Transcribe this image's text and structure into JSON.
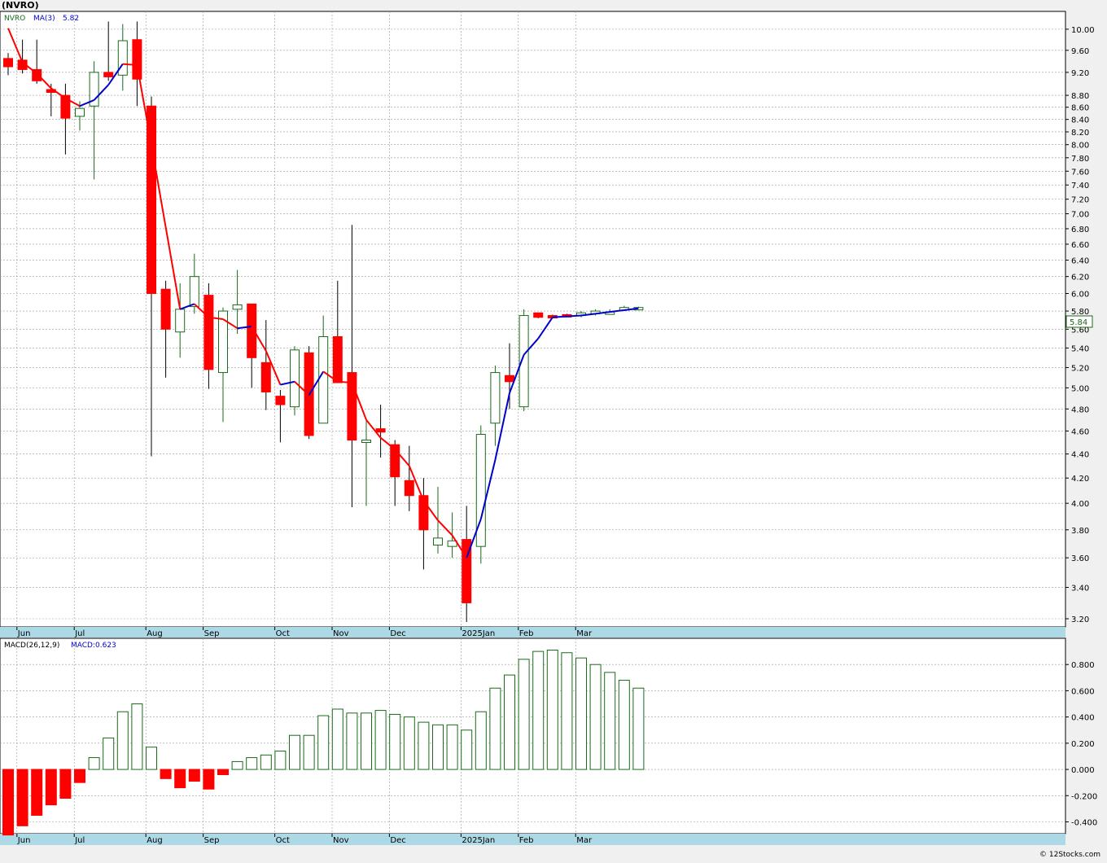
{
  "page": {
    "title": "(NVRO)",
    "footer": "© 12Stocks.com",
    "colors": {
      "up": "#1a6b1a",
      "down": "#ff0000",
      "ma_red": "#ff0000",
      "ma_blue": "#0000cc",
      "axis_band": "#add8e6",
      "grid": "#999999"
    }
  },
  "chart_data": [
    {
      "type": "candlestick",
      "legend": {
        "symbol": "NVRO",
        "ma_label": "MA(3)",
        "ma_value": "5.82"
      },
      "last_price_badge": "5.84",
      "ylim": [
        3.15,
        10.35
      ],
      "y_ticks": [
        "3.20",
        "3.40",
        "3.60",
        "3.80",
        "4.00",
        "4.20",
        "4.40",
        "4.60",
        "4.80",
        "5.00",
        "5.20",
        "5.40",
        "5.60",
        "5.80",
        "6.00",
        "6.20",
        "6.40",
        "6.60",
        "6.80",
        "7.00",
        "7.20",
        "7.40",
        "7.60",
        "7.80",
        "8.00",
        "8.20",
        "8.40",
        "8.60",
        "8.80",
        "9.20",
        "9.60",
        "10.00"
      ],
      "x_labels": [
        {
          "label": "Jun",
          "index": 1
        },
        {
          "label": "Jul",
          "index": 5
        },
        {
          "label": "Aug",
          "index": 10
        },
        {
          "label": "Sep",
          "index": 14
        },
        {
          "label": "Oct",
          "index": 19
        },
        {
          "label": "Nov",
          "index": 23
        },
        {
          "label": "Dec",
          "index": 27
        },
        {
          "label": "2025Jan",
          "index": 32
        },
        {
          "label": "Feb",
          "index": 36
        },
        {
          "label": "Mar",
          "index": 40
        }
      ],
      "candles": [
        {
          "o": 9.45,
          "h": 9.55,
          "l": 9.15,
          "c": 9.3
        },
        {
          "o": 9.42,
          "h": 9.8,
          "l": 9.18,
          "c": 9.25
        },
        {
          "o": 9.25,
          "h": 9.8,
          "l": 9.0,
          "c": 9.05
        },
        {
          "o": 8.9,
          "h": 9.0,
          "l": 8.45,
          "c": 8.85
        },
        {
          "o": 8.8,
          "h": 9.0,
          "l": 7.85,
          "c": 8.42
        },
        {
          "o": 8.45,
          "h": 8.7,
          "l": 8.22,
          "c": 8.58
        },
        {
          "o": 8.62,
          "h": 9.4,
          "l": 7.48,
          "c": 9.2
        },
        {
          "o": 9.2,
          "h": 10.15,
          "l": 9.05,
          "c": 9.12
        },
        {
          "o": 9.15,
          "h": 10.1,
          "l": 8.88,
          "c": 9.78
        },
        {
          "o": 9.8,
          "h": 10.15,
          "l": 8.62,
          "c": 9.08
        },
        {
          "o": 8.62,
          "h": 8.78,
          "l": 4.38,
          "c": 6.0
        },
        {
          "o": 6.05,
          "h": 6.15,
          "l": 5.1,
          "c": 5.6
        },
        {
          "o": 5.57,
          "h": 6.12,
          "l": 5.3,
          "c": 5.82
        },
        {
          "o": 5.85,
          "h": 6.48,
          "l": 5.77,
          "c": 6.2
        },
        {
          "o": 5.98,
          "h": 6.12,
          "l": 4.99,
          "c": 5.18
        },
        {
          "o": 5.15,
          "h": 5.84,
          "l": 4.68,
          "c": 5.8
        },
        {
          "o": 5.82,
          "h": 6.28,
          "l": 5.55,
          "c": 5.87
        },
        {
          "o": 5.88,
          "h": 5.88,
          "l": 5.0,
          "c": 5.3
        },
        {
          "o": 5.25,
          "h": 5.7,
          "l": 4.79,
          "c": 4.96
        },
        {
          "o": 4.92,
          "h": 4.98,
          "l": 4.5,
          "c": 4.84
        },
        {
          "o": 4.82,
          "h": 5.42,
          "l": 4.74,
          "c": 5.38
        },
        {
          "o": 5.35,
          "h": 5.42,
          "l": 4.53,
          "c": 4.56
        },
        {
          "o": 4.67,
          "h": 5.75,
          "l": 4.67,
          "c": 5.52
        },
        {
          "o": 5.52,
          "h": 6.15,
          "l": 5.05,
          "c": 5.05
        },
        {
          "o": 5.15,
          "h": 6.85,
          "l": 3.97,
          "c": 4.52
        },
        {
          "o": 4.52,
          "h": 4.7,
          "l": 3.98,
          "c": 4.52
        },
        {
          "o": 4.62,
          "h": 4.84,
          "l": 4.37,
          "c": 4.59
        },
        {
          "o": 4.48,
          "h": 4.52,
          "l": 3.98,
          "c": 4.21
        },
        {
          "o": 4.18,
          "h": 4.47,
          "l": 3.94,
          "c": 4.06
        },
        {
          "o": 4.06,
          "h": 4.2,
          "l": 3.52,
          "c": 3.8
        },
        {
          "o": 3.69,
          "h": 4.13,
          "l": 3.63,
          "c": 3.74
        },
        {
          "o": 3.68,
          "h": 3.93,
          "l": 3.6,
          "c": 3.72
        },
        {
          "o": 3.73,
          "h": 3.98,
          "l": 3.18,
          "c": 3.3
        },
        {
          "o": 3.68,
          "h": 4.65,
          "l": 3.56,
          "c": 4.57
        },
        {
          "o": 4.67,
          "h": 5.22,
          "l": 4.47,
          "c": 5.15
        },
        {
          "o": 5.12,
          "h": 5.45,
          "l": 4.8,
          "c": 5.06
        },
        {
          "o": 4.82,
          "h": 5.82,
          "l": 4.78,
          "c": 5.75
        },
        {
          "o": 5.78,
          "h": 5.78,
          "l": 5.72,
          "c": 5.73
        },
        {
          "o": 5.75,
          "h": 5.76,
          "l": 5.73,
          "c": 5.74
        },
        {
          "o": 5.76,
          "h": 5.77,
          "l": 5.73,
          "c": 5.74
        },
        {
          "o": 5.75,
          "h": 5.8,
          "l": 5.73,
          "c": 5.78
        },
        {
          "o": 5.77,
          "h": 5.82,
          "l": 5.75,
          "c": 5.8
        },
        {
          "o": 5.79,
          "h": 5.82,
          "l": 5.76,
          "c": 5.79
        },
        {
          "o": 5.81,
          "h": 5.86,
          "l": 5.8,
          "c": 5.84
        },
        {
          "o": 5.83,
          "h": 5.85,
          "l": 5.82,
          "c": 5.84
        }
      ],
      "ma3": [
        10.02,
        9.38,
        9.18,
        8.92,
        8.75,
        8.62,
        8.72,
        8.98,
        9.35,
        9.33,
        8.0,
        6.82,
        5.82,
        5.88,
        5.73,
        5.71,
        5.61,
        5.63,
        5.37,
        5.03,
        5.06,
        4.93,
        5.16,
        5.06,
        5.05,
        4.7,
        4.54,
        4.44,
        4.3,
        4.02,
        3.87,
        3.76,
        3.6,
        3.88,
        4.35,
        4.95,
        5.33,
        5.5,
        5.73,
        5.74,
        5.75,
        5.77,
        5.79,
        5.81,
        5.83
      ]
    },
    {
      "type": "bar",
      "legend": {
        "label": "MACD(26,12,9)",
        "value_label": "MACD:0.623"
      },
      "ylim": [
        -0.49,
        1.0
      ],
      "y_ticks": [
        "-0.400",
        "-0.200",
        "0.000",
        "0.200",
        "0.400",
        "0.600",
        "0.800"
      ],
      "x_labels": [
        {
          "label": "Jun",
          "index": 1
        },
        {
          "label": "Jul",
          "index": 5
        },
        {
          "label": "Aug",
          "index": 10
        },
        {
          "label": "Sep",
          "index": 14
        },
        {
          "label": "Oct",
          "index": 19
        },
        {
          "label": "Nov",
          "index": 23
        },
        {
          "label": "Dec",
          "index": 27
        },
        {
          "label": "2025Jan",
          "index": 32
        },
        {
          "label": "Feb",
          "index": 36
        },
        {
          "label": "Mar",
          "index": 40
        }
      ],
      "values": [
        -0.5,
        -0.43,
        -0.35,
        -0.27,
        -0.22,
        -0.1,
        0.09,
        0.24,
        0.44,
        0.5,
        0.17,
        -0.07,
        -0.14,
        -0.09,
        -0.15,
        -0.04,
        0.06,
        0.09,
        0.11,
        0.14,
        0.26,
        0.26,
        0.41,
        0.46,
        0.43,
        0.43,
        0.45,
        0.42,
        0.4,
        0.36,
        0.34,
        0.34,
        0.3,
        0.44,
        0.62,
        0.72,
        0.84,
        0.9,
        0.91,
        0.89,
        0.85,
        0.8,
        0.74,
        0.68,
        0.62
      ]
    }
  ]
}
